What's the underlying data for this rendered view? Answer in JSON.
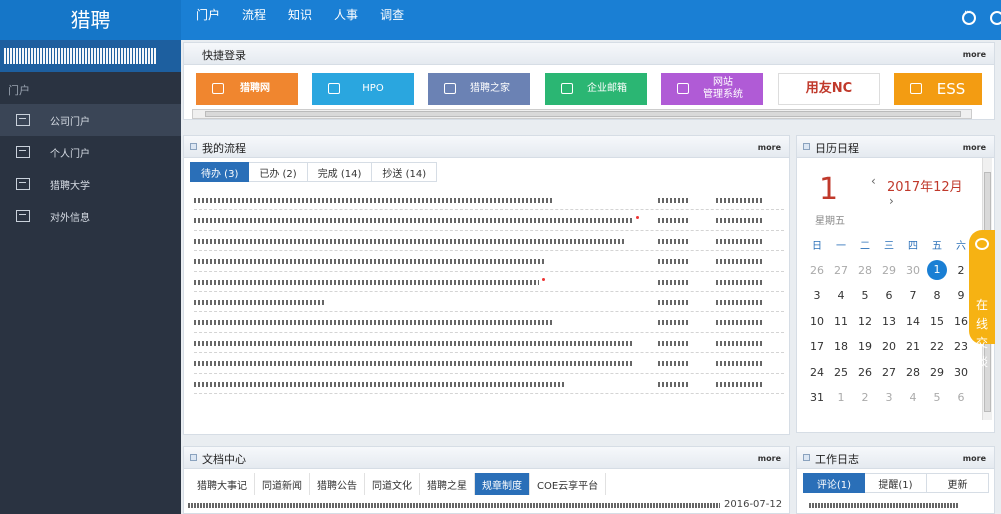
{
  "app": {
    "logo": "猎聘"
  },
  "topnav": [
    "门户",
    "流程",
    "知识",
    "人事",
    "调查"
  ],
  "sidebar": {
    "section": "门户",
    "items": [
      {
        "label": "公司门户",
        "active": true
      },
      {
        "label": "个人门户",
        "active": false
      },
      {
        "label": "猎聘大学",
        "active": false
      },
      {
        "label": "对外信息",
        "active": false
      }
    ]
  },
  "quick_login": {
    "title": "快捷登录",
    "more": "more",
    "tiles": [
      {
        "label": "猎聘网",
        "color": "#f0862f"
      },
      {
        "label": "HPO",
        "color": "#2aa6df"
      },
      {
        "label": "猎聘之家",
        "color": "#6b82b4"
      },
      {
        "label": "企业邮箱",
        "color": "#2bb673"
      },
      {
        "label": "网站\n管理系统",
        "color": "#b05bd6"
      },
      {
        "label": "用友NC",
        "color": "#ffffff"
      },
      {
        "label": "ESS",
        "color": "#f39c12"
      }
    ]
  },
  "my_flow": {
    "title": "我的流程",
    "more": "more",
    "tabs": [
      {
        "label": "待办 (3)",
        "active": true
      },
      {
        "label": "已办 (2)",
        "active": false
      },
      {
        "label": "完成 (14)",
        "active": false
      },
      {
        "label": "抄送 (14)",
        "active": false
      }
    ]
  },
  "calendar": {
    "title": "日历日程",
    "more": "more",
    "day": "1",
    "weekday": "星期五",
    "month": "2017年12月",
    "prev": "‹",
    "next": "›",
    "headers": [
      "日",
      "一",
      "二",
      "三",
      "四",
      "五",
      "六"
    ],
    "rows": [
      [
        "26",
        "27",
        "28",
        "29",
        "30",
        "1",
        "2"
      ],
      [
        "3",
        "4",
        "5",
        "6",
        "7",
        "8",
        "9"
      ],
      [
        "10",
        "11",
        "12",
        "13",
        "14",
        "15",
        "16"
      ],
      [
        "17",
        "18",
        "19",
        "20",
        "21",
        "22",
        "23"
      ],
      [
        "24",
        "25",
        "26",
        "27",
        "28",
        "29",
        "30"
      ],
      [
        "31",
        "1",
        "2",
        "3",
        "4",
        "5",
        "6"
      ]
    ]
  },
  "chat": {
    "label": "在\n线\n交\n谈"
  },
  "doc_center": {
    "title": "文档中心",
    "more": "more",
    "tabs": [
      {
        "label": "猎聘大事记",
        "active": false
      },
      {
        "label": "同道新闻",
        "active": false
      },
      {
        "label": "猎聘公告",
        "active": false
      },
      {
        "label": "同道文化",
        "active": false
      },
      {
        "label": "猎聘之星",
        "active": false
      },
      {
        "label": "规章制度",
        "active": true
      },
      {
        "label": "COE云享平台",
        "active": false
      }
    ],
    "first_date": "2016-07-12"
  },
  "work_log": {
    "title": "工作日志",
    "more": "more",
    "tabs": [
      {
        "label": "评论(1)",
        "active": true
      },
      {
        "label": "提醒(1)",
        "active": false
      },
      {
        "label": "更新",
        "active": false
      }
    ]
  }
}
